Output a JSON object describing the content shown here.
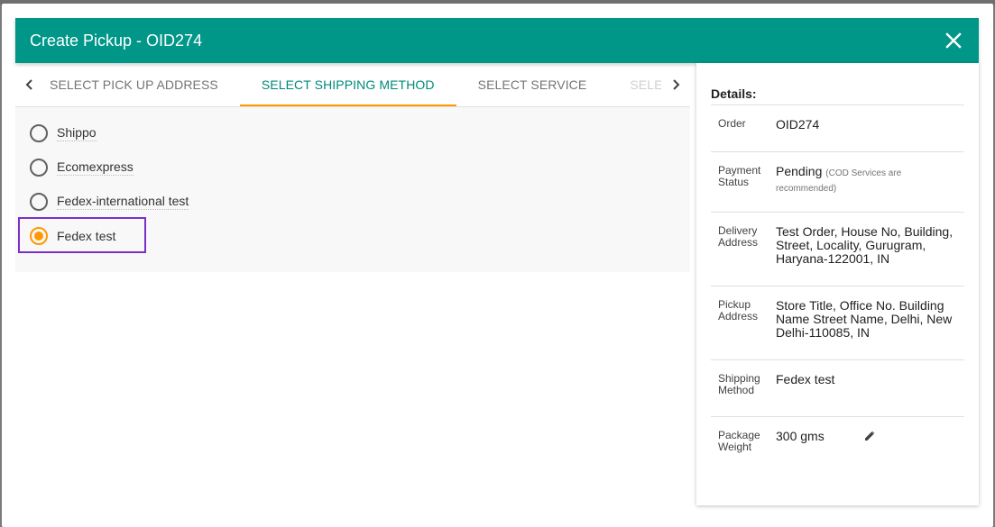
{
  "dialog": {
    "title": "Create Pickup - OID274",
    "close_icon": "close-icon"
  },
  "tabs": [
    {
      "label": "SELECT PICK UP ADDRESS"
    },
    {
      "label": "SELECT SHIPPING METHOD"
    },
    {
      "label": "SELECT SERVICE"
    },
    {
      "label": "SELEC"
    }
  ],
  "active_tab": 1,
  "methods": [
    {
      "label": "Shippo",
      "checked": false
    },
    {
      "label": "Ecomexpress",
      "checked": false
    },
    {
      "label": "Fedex-international test",
      "checked": false
    },
    {
      "label": "Fedex test",
      "checked": true
    }
  ],
  "details": {
    "heading": "Details:",
    "rows": [
      {
        "key": "Order",
        "value": "OID274"
      },
      {
        "key": "Payment Status",
        "value": "Pending",
        "note": "(COD Services are recommended)"
      },
      {
        "key": "Delivery Address",
        "value": "Test Order, House No, Building, Street, Locality, Gurugram, Haryana-122001, IN"
      },
      {
        "key": "Pickup Address",
        "value": "Store Title, Office No. Building Name Street Name, Delhi, New Delhi-110085, IN"
      },
      {
        "key": "Shipping Method",
        "value": "Fedex test"
      },
      {
        "key": "Package Weight",
        "value": "300 gms"
      }
    ]
  },
  "colors": {
    "header": "#009688",
    "accent": "#ff9800",
    "active_tab_text": "#00897b",
    "highlight": "#7b2fc9"
  }
}
